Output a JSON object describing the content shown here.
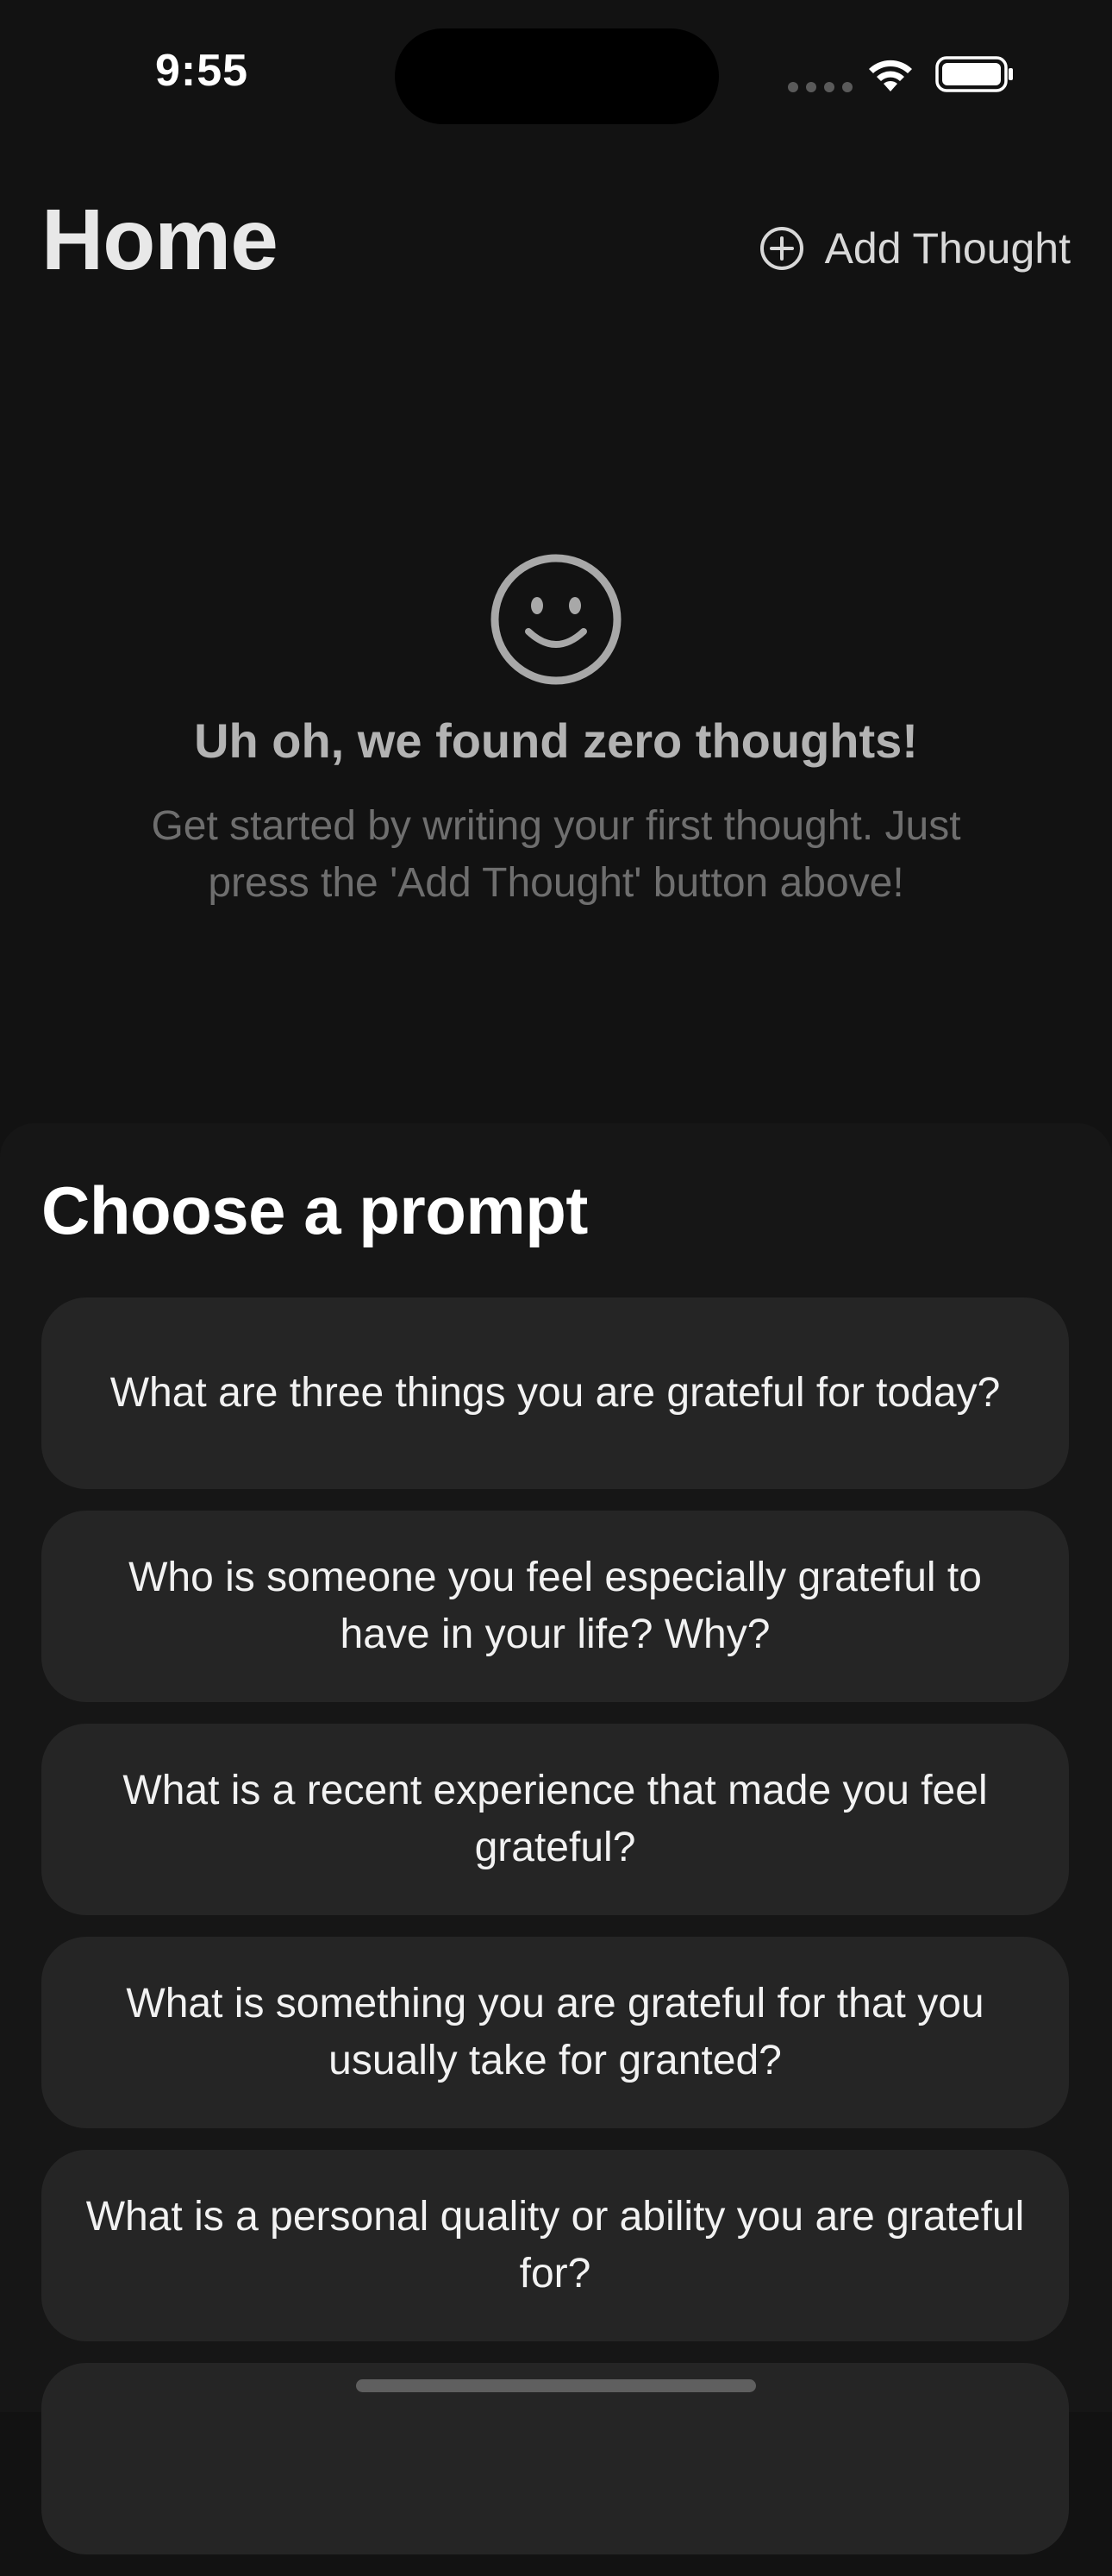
{
  "status_bar": {
    "time": "9:55"
  },
  "header": {
    "title": "Home",
    "add_thought_label": "Add Thought"
  },
  "empty_state": {
    "icon": "smiley-face-icon",
    "title": "Uh oh, we found zero thoughts!",
    "body": "Get started by writing your first thought. Just press the 'Add Thought' button above!"
  },
  "prompts": {
    "heading": "Choose a prompt",
    "items": [
      {
        "text": "What are three things you are grateful for today?"
      },
      {
        "text": "Who is someone you feel especially grateful to have in your life? Why?"
      },
      {
        "text": "What is a recent experience that made you feel grateful?"
      },
      {
        "text": "What is something you are grateful for that you usually take for granted?"
      },
      {
        "text": "What is a personal quality or ability you are grateful for?"
      },
      {
        "text": ""
      }
    ]
  },
  "colors": {
    "background": "#121212",
    "card": "#252525",
    "muted_text": "#6e6e6e"
  }
}
